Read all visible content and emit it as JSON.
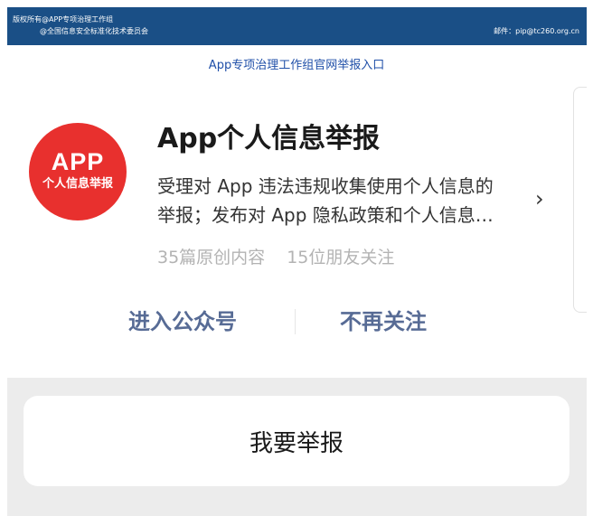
{
  "header": {
    "copyright_line1": "版权所有@APP专项治理工作组",
    "copyright_line2": "@全国信息安全标准化技术委员会",
    "email": "邮件：pip@tc260.org.cn"
  },
  "portal_link": "App专项治理工作组官网举报入口",
  "account": {
    "logo_text_top": "APP",
    "logo_text_bottom": "个人信息举报",
    "name": "App个人信息举报",
    "description_line1": "受理对 App 违法违规收集使用个人信息的",
    "description_line2": "举报；发布对 App 隐私政策和个人信息…",
    "articles": "35篇原创内容",
    "followers": "15位朋友关注",
    "enter_button": "进入公众号",
    "unfollow_button": "不再关注"
  },
  "report_button": "我要举报",
  "icons": {
    "detail": "chevron-right-icon"
  },
  "colors": {
    "header_bg": "#1a4f86",
    "logo_red": "#e8302e",
    "action_blue": "#576b95",
    "link_blue": "#1f4fa8"
  }
}
